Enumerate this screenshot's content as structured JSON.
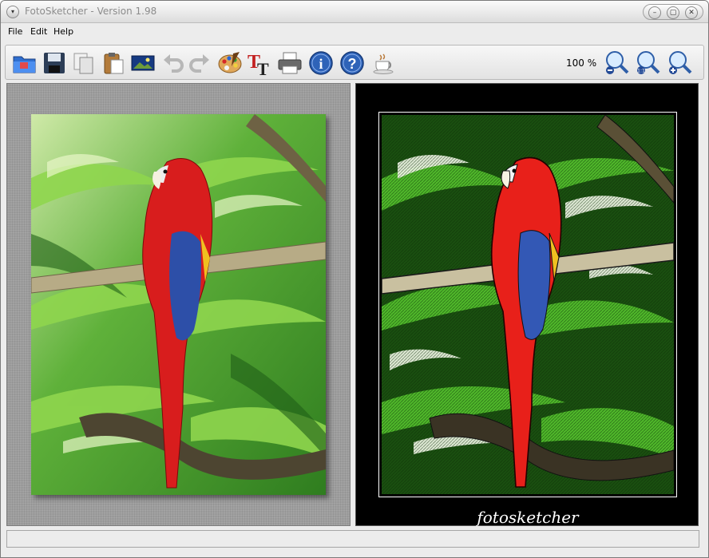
{
  "window": {
    "title": "FotoSketcher - Version 1.98"
  },
  "menubar": {
    "items": [
      "File",
      "Edit",
      "Help"
    ]
  },
  "toolbar": {
    "buttons": [
      {
        "name": "open-folder-icon"
      },
      {
        "name": "save-icon"
      },
      {
        "name": "copy-icon"
      },
      {
        "name": "paste-icon"
      },
      {
        "name": "image-icon"
      },
      {
        "name": "undo-icon"
      },
      {
        "name": "redo-icon"
      },
      {
        "name": "palette-icon"
      },
      {
        "name": "text-icon"
      },
      {
        "name": "print-icon"
      },
      {
        "name": "info-icon"
      },
      {
        "name": "help-icon"
      },
      {
        "name": "coffee-icon"
      }
    ],
    "zoom_level": "100 %",
    "zoom_out": "zoom-out-icon",
    "zoom_actual": "zoom-actual-size-icon",
    "zoom_in": "zoom-in-icon"
  },
  "canvas": {
    "signature": "fotosketcher"
  },
  "colors": {
    "accent_blue": "#2e63b8",
    "parrot_red": "#d81d1d",
    "jungle_green": "#3f9a2a"
  },
  "statusbar": {
    "text": ""
  }
}
